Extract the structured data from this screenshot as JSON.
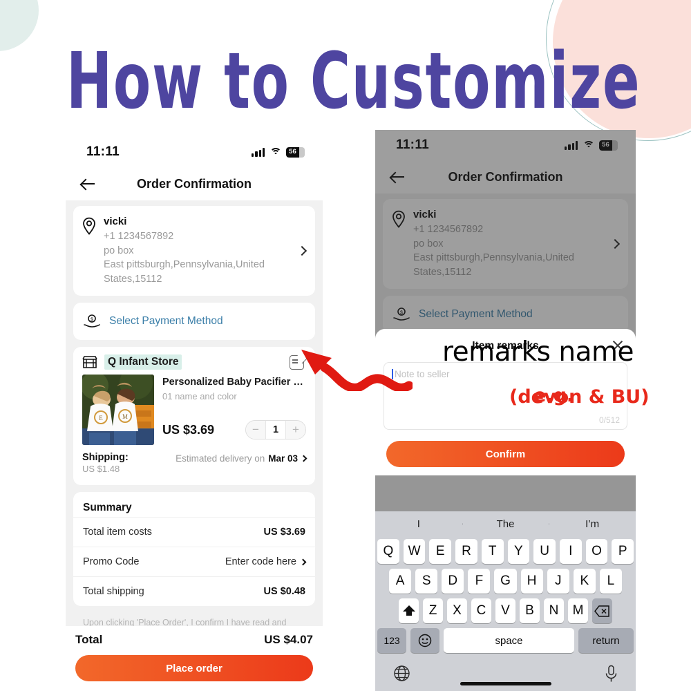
{
  "banner": {
    "title": "How to Customize"
  },
  "colors": {
    "title_purple": "#4e45a0",
    "mint": "#e2eeeb",
    "pink": "#fbe0da",
    "teal_outline": "#9dc3c2",
    "cta_orange_start": "#f2682a",
    "cta_orange_end": "#ec3a1a",
    "annotation_red": "#e8291b",
    "link_blue": "#3a7ea8",
    "store_highlight": "#d8efe9"
  },
  "status_bar": {
    "time": "11:11",
    "battery_level": "56",
    "signal_icon": "cellular-bars-icon",
    "wifi_icon": "wifi-icon",
    "battery_icon": "battery-icon"
  },
  "nav": {
    "back_icon": "back-arrow-icon",
    "title": "Order Confirmation"
  },
  "address": {
    "pin_icon": "location-pin-icon",
    "name": "vicki",
    "phone": "+1 1234567892",
    "line1": "po box",
    "line2": "East pittsburgh,Pennsylvania,United",
    "line3": "States,15112",
    "chevron_icon": "chevron-right-icon"
  },
  "payment": {
    "icon": "payment-hand-coin-icon",
    "label": "Select Payment Method"
  },
  "store": {
    "icon": "storefront-icon",
    "name": "Q Infant Store",
    "remarks_icon": "edit-remarks-icon"
  },
  "product": {
    "image_alt": "two-girls-white-shirts-pumpkins-photo",
    "title": "Personalized Baby Pacifier Clip Custo…",
    "variant": "01 name and color",
    "price": "US $3.69",
    "quantity": "1",
    "minus_label": "−",
    "plus_label": "+"
  },
  "shipping": {
    "label": "Shipping:",
    "cost": "US $1.48",
    "delivery_prefix": "Estimated delivery on",
    "delivery_date": "Mar 03",
    "chevron_icon": "chevron-right-icon"
  },
  "summary": {
    "title": "Summary",
    "rows": [
      {
        "label": "Total item costs",
        "value": "US $3.69",
        "is_link": false
      },
      {
        "label": "Promo Code",
        "value": "Enter code here",
        "is_link": true
      },
      {
        "label": "Total shipping",
        "value": "US $0.48",
        "is_link": false
      }
    ],
    "disclaimer": "Upon clicking 'Place Order', I confirm I have read and"
  },
  "bottom_bar": {
    "total_label": "Total",
    "total_amount": "US $4.07",
    "cta_label": "Place order"
  },
  "modal": {
    "title": "Item remarks",
    "close_icon": "close-x-icon",
    "placeholder": "Note to seller",
    "counter": "0/512",
    "confirm_label": "Confirm"
  },
  "annotations": {
    "remarks_name": "remarks name",
    "eg": "e.g.",
    "devon": "(devon & BU)",
    "arrow_icon": "red-wavy-arrow-icon"
  },
  "keyboard": {
    "suggestions": [
      "I",
      "The",
      "I’m"
    ],
    "row1": [
      "Q",
      "W",
      "E",
      "R",
      "T",
      "Y",
      "U",
      "I",
      "O",
      "P"
    ],
    "row2": [
      "A",
      "S",
      "D",
      "F",
      "G",
      "H",
      "J",
      "K",
      "L"
    ],
    "row3": [
      "Z",
      "X",
      "C",
      "V",
      "B",
      "N",
      "M"
    ],
    "shift_icon": "shift-arrow-icon",
    "backspace_icon": "backspace-icon",
    "numbers_label": "123",
    "emoji_icon": "emoji-smiley-icon",
    "space_label": "space",
    "return_label": "return",
    "globe_icon": "globe-icon",
    "mic_icon": "microphone-icon"
  }
}
